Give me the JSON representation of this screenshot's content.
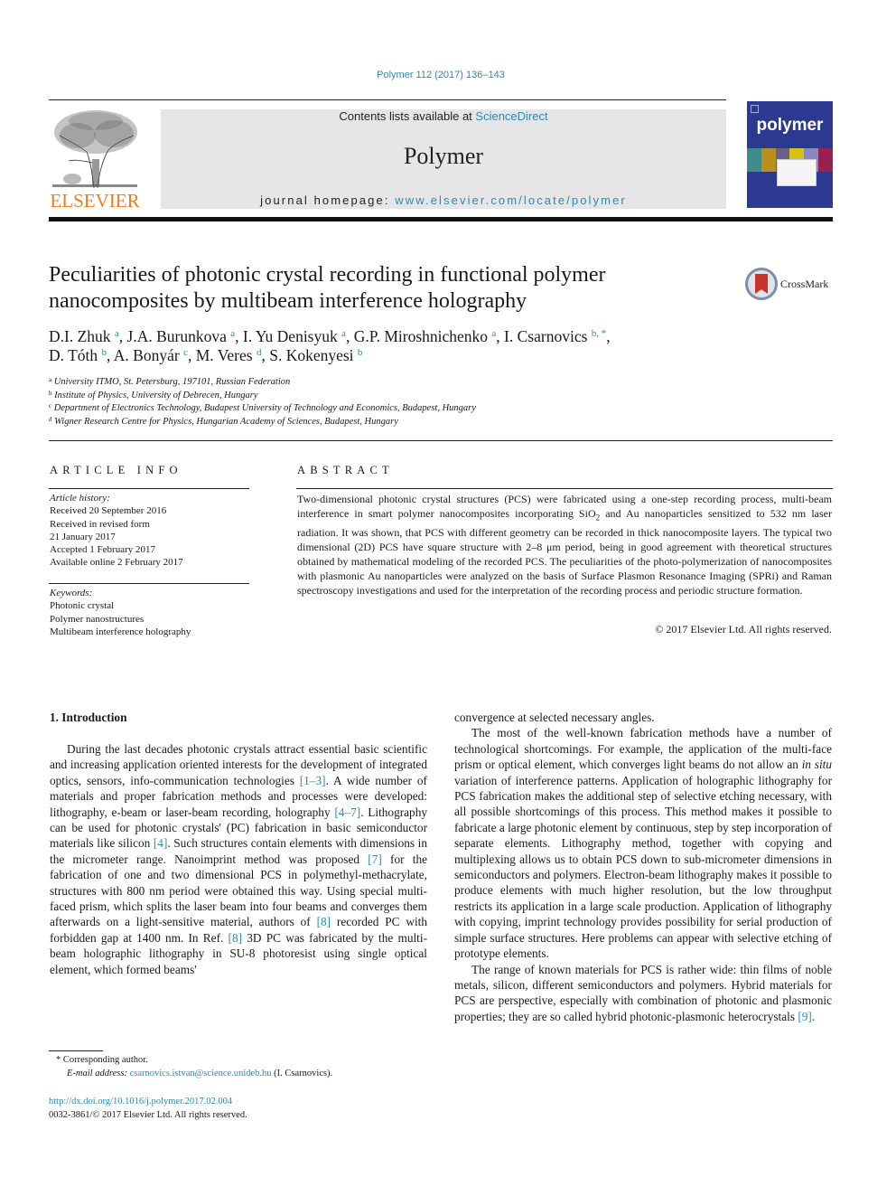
{
  "header": {
    "citation": "Polymer 112 (2017) 136–143",
    "contents_prefix": "Contents lists available at ",
    "contents_link": "ScienceDirect",
    "journal_name": "Polymer",
    "homepage_prefix": "journal homepage: ",
    "homepage_link": "www.elsevier.com/locate/polymer",
    "publisher_logo_text": "ELSEVIER",
    "cover_title": "polymer",
    "colors": {
      "link": "#2a8ab8",
      "elsevier_orange": "#f07c1b",
      "cover_blue": "#2b3990",
      "banner_gray": "#e6e6e6"
    }
  },
  "article": {
    "title_line1": "Peculiarities of photonic crystal recording in functional polymer",
    "title_line2": "nanocomposites by multibeam interference holography",
    "crossmark_label": "CrossMark",
    "authors": [
      {
        "name": "D.I. Zhuk",
        "aff": "a"
      },
      {
        "name": "J.A. Burunkova",
        "aff": "a"
      },
      {
        "name": "I. Yu Denisyuk",
        "aff": "a"
      },
      {
        "name": "G.P. Miroshnichenko",
        "aff": "a"
      },
      {
        "name": "I. Csarnovics",
        "aff": "b, *"
      },
      {
        "name": "D. Tóth",
        "aff": "b"
      },
      {
        "name": "A. Bonyár",
        "aff": "c"
      },
      {
        "name": "M. Veres",
        "aff": "d"
      },
      {
        "name": "S. Kokenyesi",
        "aff": "b"
      }
    ],
    "affiliations": [
      {
        "key": "a",
        "text": "University ITMO, St. Petersburg, 197101, Russian Federation"
      },
      {
        "key": "b",
        "text": "Institute of Physics, University of Debrecen, Hungary"
      },
      {
        "key": "c",
        "text": "Department of Electronics Technology, Budapest University of Technology and Economics, Budapest, Hungary"
      },
      {
        "key": "d",
        "text": "Wigner Research Centre for Physics, Hungarian Academy of Sciences, Budapest, Hungary"
      }
    ]
  },
  "article_info": {
    "heading": "ARTICLE INFO",
    "history_label": "Article history:",
    "history": [
      "Received 20 September 2016",
      "Received in revised form",
      "21 January 2017",
      "Accepted 1 February 2017",
      "Available online 2 February 2017"
    ],
    "keywords_label": "Keywords:",
    "keywords": [
      "Photonic crystal",
      "Polymer nanostructures",
      "Multibeam interference holography"
    ]
  },
  "abstract": {
    "heading": "ABSTRACT",
    "text_part1": "Two-dimensional photonic crystal structures (PCS) were fabricated using a one-step recording process, multi-beam interference in smart polymer nanocomposites incorporating SiO",
    "text_sub": "2",
    "text_part2": " and Au nanoparticles sensitized to 532 nm laser radiation. It was shown, that PCS with different geometry can be recorded in thick nanocomposite layers. The typical two dimensional (2D) PCS have square structure with 2–8 μm period, being in good agreement with theoretical structures obtained by mathematical modeling of the recorded PCS. The peculiarities of the photo-polymerization of nanocomposites with plasmonic Au nanoparticles were analyzed on the basis of Surface Plasmon Resonance Imaging (SPRi) and Raman spectroscopy investigations and used for the interpretation of the recording process and periodic structure formation.",
    "copyright": "© 2017 Elsevier Ltd. All rights reserved."
  },
  "body": {
    "section_title": "1.  Introduction",
    "left_p1": [
      {
        "t": "During the last decades photonic crystals attract essential basic scientific and increasing application oriented interests for the development of integrated optics, sensors, info-communication technologies "
      },
      {
        "ref": "[1–3]"
      },
      {
        "t": ". A wide number of materials and proper fabrication methods and processes were developed: lithography, e-beam or laser-beam recording, holography "
      },
      {
        "ref": "[4–7]"
      },
      {
        "t": ". Lithography can be used for photonic crystals' (PC) fabrication in basic semiconductor materials like silicon "
      },
      {
        "ref": "[4]"
      },
      {
        "t": ". Such structures contain elements with dimensions in the micrometer range. Nanoimprint method was proposed "
      },
      {
        "ref": "[7]"
      },
      {
        "t": " for the fabrication of one and two dimensional PCS in polymethyl-methacrylate, structures with 800 nm period were obtained this way. Using special multi-faced prism, which splits the laser beam into four beams and converges them afterwards on a light-sensitive material, authors of "
      },
      {
        "ref": "[8]"
      },
      {
        "t": " recorded PC with forbidden gap at 1400 nm. In Ref. "
      },
      {
        "ref": "[8]"
      },
      {
        "t": " 3D PC was fabricated by the multi-beam holographic lithography in SU-8 photoresist using single optical element, which formed beams'"
      }
    ],
    "right_continuation": "convergence at selected necessary angles.",
    "right_p2_a": "The most of the well-known fabrication methods have a number of technological shortcomings. For example, the application of the multi-face prism or optical element, which converges light beams do not allow an ",
    "right_p2_italic": "in situ",
    "right_p2_b": " variation of interference patterns. Application of holographic lithography for PCS fabrication makes the additional step of selective etching necessary, with all possible shortcomings of this process. This method makes it possible to fabricate a large photonic element by continuous, step by step incorporation of separate elements. Lithography method, together with copying and multiplexing allows us to obtain PCS down to sub-micrometer dimensions in semiconductors and polymers. Electron-beam lithography makes it possible to produce elements with much higher resolution, but the low throughput restricts its application in a large scale production. Application of lithography with copying, imprint technology provides possibility for serial production of simple surface structures. Here problems can appear with selective etching of prototype elements.",
    "right_p3_a": "The range of known materials for PCS is rather wide: thin films of noble metals, silicon, different semiconductors and polymers. Hybrid materials for PCS are perspective, especially with combination of photonic and plasmonic properties; they are so called hybrid photonic-plasmonic heterocrystals ",
    "right_p3_ref": "[9]",
    "right_p3_b": "."
  },
  "footer": {
    "corresponding": "* Corresponding author.",
    "email_label": "E-mail address: ",
    "email": "csarnovics.istvan@science.unideb.hu",
    "email_suffix": " (I. Csarnovics).",
    "doi": "http://dx.doi.org/10.1016/j.polymer.2017.02.004",
    "issn": "0032-3861/© 2017 Elsevier Ltd. All rights reserved."
  }
}
